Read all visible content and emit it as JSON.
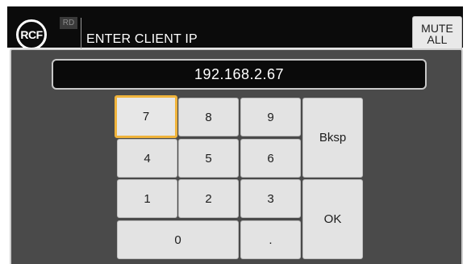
{
  "header": {
    "logo_text": "RCF",
    "badge": "RD",
    "title": "ENTER CLIENT IP",
    "mute_line1": "MUTE",
    "mute_line2": "ALL"
  },
  "display": {
    "value": "192.168.2.67"
  },
  "keypad": {
    "k7": "7",
    "k8": "8",
    "k9": "9",
    "k4": "4",
    "k5": "5",
    "k6": "6",
    "k1": "1",
    "k2": "2",
    "k3": "3",
    "k0": "0",
    "dot": ".",
    "backspace": "Bksp",
    "ok": "OK"
  },
  "colors": {
    "header_bg": "#0b0b0b",
    "panel_bg": "#4a4a4a",
    "key_bg": "#e3e3e3",
    "focus_outline": "#f0b43c"
  }
}
